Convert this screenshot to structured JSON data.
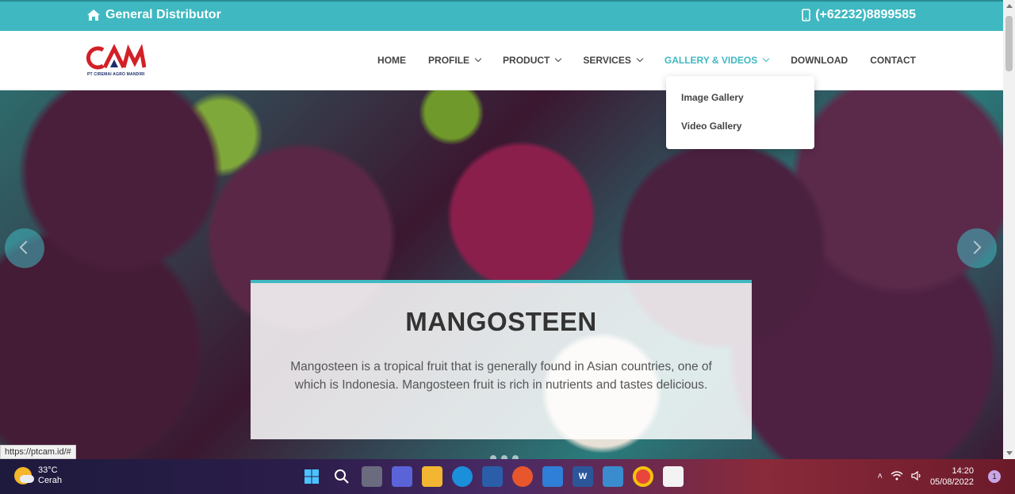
{
  "topbar": {
    "left_text": "General Distributor",
    "right_text": "(+62232)8899585"
  },
  "logo": {
    "text": "CAM",
    "subtitle": "PT CIREMAI AGRO MANDIRI"
  },
  "menu": [
    {
      "label": "HOME",
      "has_dropdown": false,
      "active": false
    },
    {
      "label": "PROFILE",
      "has_dropdown": true,
      "active": false
    },
    {
      "label": "PRODUCT",
      "has_dropdown": true,
      "active": false
    },
    {
      "label": "SERVICES",
      "has_dropdown": true,
      "active": false
    },
    {
      "label": "GALLERY & VIDEOS",
      "has_dropdown": true,
      "active": true
    },
    {
      "label": "DOWNLOAD",
      "has_dropdown": false,
      "active": false
    },
    {
      "label": "CONTACT",
      "has_dropdown": false,
      "active": false
    }
  ],
  "dropdown": {
    "items": [
      "Image Gallery",
      "Video Gallery"
    ]
  },
  "hero": {
    "title": "MANGOSTEEN",
    "description": "Mangosteen is a tropical fruit that is generally found in Asian countries, one of which is Indonesia. Mangosteen fruit is rich in nutrients and tastes delicious."
  },
  "status_url": "https://ptcam.id/#",
  "taskbar": {
    "temperature": "33°C",
    "weather": "Cerah",
    "time": "14:20",
    "date": "05/08/2022",
    "notifications": "1"
  },
  "colors": {
    "accent": "#3fb8c1",
    "logo_red": "#d32027",
    "logo_blue": "#1c2d6b"
  }
}
